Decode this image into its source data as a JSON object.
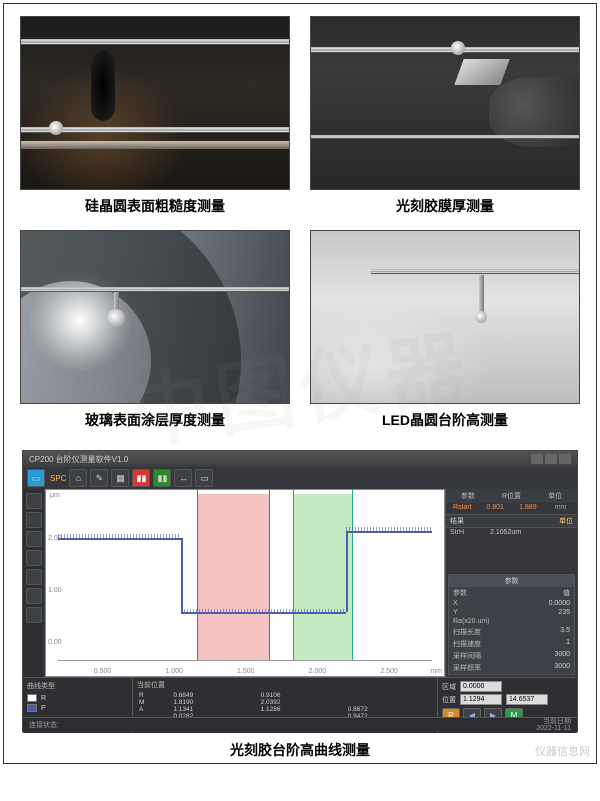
{
  "captions": {
    "img1": "硅晶圆表面粗糙度测量",
    "img2": "光刻胶膜厚测量",
    "img3": "玻璃表面涂层厚度测量",
    "img4": "LED晶圆台阶高测量",
    "software": "光刻胶台阶高曲线测量"
  },
  "software": {
    "title": "CP200 台阶仪测量软件V1.0",
    "toolbar": {
      "spc": "SPC"
    },
    "right_panel": {
      "header": [
        "参数",
        "R位置",
        "单位"
      ],
      "row1": [
        "Rstart",
        "0.801",
        "1.889",
        "mm"
      ],
      "result_header": "结果",
      "result_unit_label": "单位",
      "results": [
        {
          "k": "StrH",
          "v": "2.1052",
          "u": "um"
        }
      ],
      "params_title": "参数",
      "params": [
        {
          "k": "参数",
          "v": "值"
        },
        {
          "k": "X",
          "v": "0.0000"
        },
        {
          "k": "Y",
          "v": "235"
        },
        {
          "k": "Ra(x20.um)",
          "v": ""
        },
        {
          "k": "扫描长度",
          "v": "3.5"
        },
        {
          "k": "扫描速度",
          "v": "1"
        },
        {
          "k": "采样间隔",
          "v": "3000"
        },
        {
          "k": "采样频率",
          "v": "3000"
        }
      ]
    },
    "plot": {
      "y_unit": "μm",
      "y_ticks": [
        "2.00",
        "1.00",
        "0.00"
      ],
      "x_ticks": [
        "0.500",
        "1.000",
        "1.500",
        "2.000",
        "2.500",
        "mm"
      ]
    },
    "legend": {
      "title": "曲线类型",
      "items": [
        {
          "label": "R",
          "color": "#ffffff"
        },
        {
          "label": "P",
          "color": "#4a5fb0"
        }
      ]
    },
    "table": {
      "title": "当前位置",
      "rows": [
        [
          "R",
          "0.6849",
          "0.9106",
          ""
        ],
        [
          "M",
          "1.8190",
          "2.0392",
          ""
        ],
        [
          "A",
          "1.1341",
          "1.1286",
          "0.8672"
        ],
        [
          "",
          "0.0282",
          "",
          "0.9472"
        ]
      ]
    },
    "controls": {
      "region_label": "区域",
      "region_val": "0.0000",
      "step_label": "位置",
      "step_val": "1.1294",
      "step2_val": "14.6537"
    },
    "status": {
      "left": "连接状态:",
      "date_label": "当前日期",
      "date": "2022-11-11"
    }
  },
  "watermark": "中图仪器",
  "corner_watermark": "仪器信息网"
}
